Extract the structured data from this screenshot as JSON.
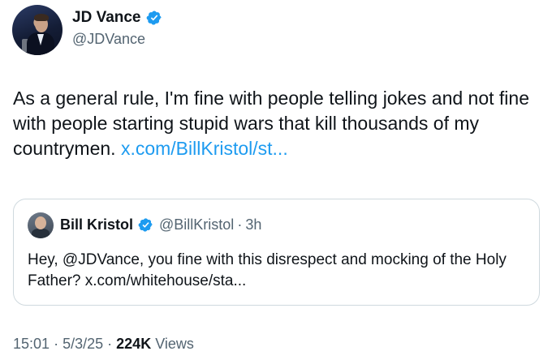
{
  "author": {
    "name": "JD Vance",
    "handle": "@JDVance"
  },
  "tweet": {
    "text": "As a general rule, I'm fine with people telling jokes and not fine with people starting stupid wars that kill thousands of my countrymen.",
    "link": "x.com/BillKristol/st..."
  },
  "quote": {
    "name": "Bill Kristol",
    "handle": "@BillKristol",
    "separator": "·",
    "time": "3h",
    "text": "Hey, @JDVance, you fine with this disrespect and mocking of the Holy Father?",
    "link": "x.com/whitehouse/sta..."
  },
  "meta": {
    "time": "15:01",
    "sep1": "·",
    "date": "5/3/25",
    "sep2": "·",
    "views_count": "224K",
    "views_label": "Views"
  },
  "colors": {
    "link": "#1d9bf0",
    "verified_badge": "#1d9bf0",
    "secondary_text": "#536471"
  }
}
